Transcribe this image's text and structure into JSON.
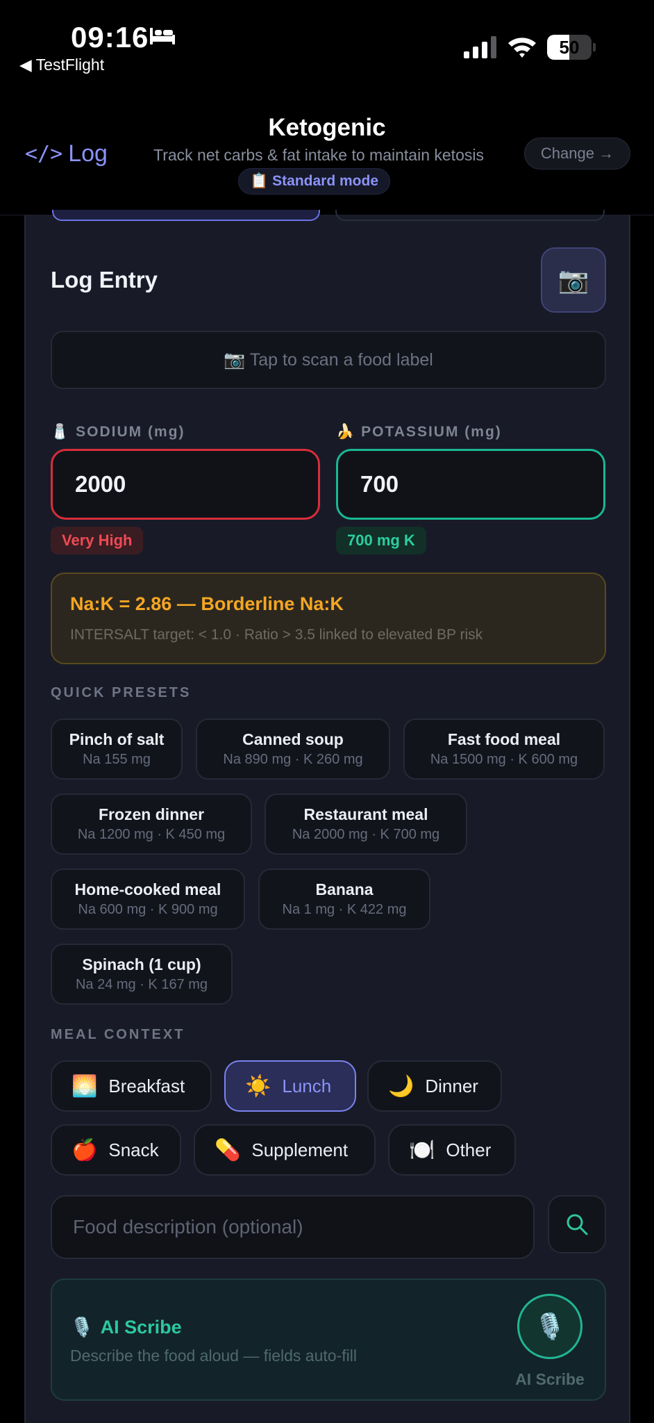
{
  "status_bar": {
    "time": "09:16",
    "back_app": "◀ TestFlight",
    "battery_percent": 50,
    "battery_text": "50"
  },
  "header": {
    "log_label": "Log",
    "title": "Ketogenic",
    "subtitle": "Track net carbs & fat intake to maintain ketosis",
    "mode_icon": "📋",
    "mode_label": "Standard mode",
    "change_label": "Change →"
  },
  "entry": {
    "title": "Log Entry",
    "camera_icon": "📷",
    "scan_label": "📷 Tap to scan a food label",
    "sodium": {
      "icon": "🧂",
      "label": "SODIUM (mg)",
      "value": "2000",
      "badge": "Very High"
    },
    "potassium": {
      "icon": "🍌",
      "label": "POTASSIUM (mg)",
      "value": "700",
      "badge": "700 mg K"
    },
    "ratio": {
      "title": "Na:K = 2.86 — Borderline Na:K",
      "subtitle": "INTERSALT target: < 1.0 · Ratio > 3.5 linked to elevated BP risk"
    }
  },
  "presets": {
    "label": "QUICK PRESETS",
    "items": [
      {
        "name": "Pinch of salt",
        "values": "Na 155 mg"
      },
      {
        "name": "Canned soup",
        "values": "Na 890 mg · K 260 mg"
      },
      {
        "name": "Fast food meal",
        "values": "Na 1500 mg · K 600 mg"
      },
      {
        "name": "Frozen dinner",
        "values": "Na 1200 mg · K 450 mg"
      },
      {
        "name": "Restaurant meal",
        "values": "Na 2000 mg · K 700 mg"
      },
      {
        "name": "Home-cooked meal",
        "values": "Na 600 mg · K 900 mg"
      },
      {
        "name": "Banana",
        "values": "Na 1 mg · K 422 mg"
      },
      {
        "name": "Spinach (1 cup)",
        "values": "Na 24 mg · K 167 mg"
      }
    ]
  },
  "meal_context": {
    "label": "MEAL CONTEXT",
    "selected": "Lunch",
    "items": [
      {
        "emoji": "🌅",
        "label": "Breakfast"
      },
      {
        "emoji": "☀️",
        "label": "Lunch"
      },
      {
        "emoji": "🌙",
        "label": "Dinner"
      },
      {
        "emoji": "🍎",
        "label": "Snack"
      },
      {
        "emoji": "💊",
        "label": "Supplement"
      },
      {
        "emoji": "🍽️",
        "label": "Other"
      }
    ]
  },
  "food": {
    "placeholder": "Food description (optional)",
    "value": ""
  },
  "ai_scribe": {
    "icon": "🎙️",
    "title": "AI Scribe",
    "subtitle": "Describe the food aloud — fields auto-fill",
    "button_label": "AI Scribe"
  },
  "colors": {
    "accent": "#8b93f7",
    "sodium_high": "#d92d3a",
    "potassium_ok": "#19b894",
    "warning": "#f5a623",
    "scribe": "#2cc8a0"
  }
}
